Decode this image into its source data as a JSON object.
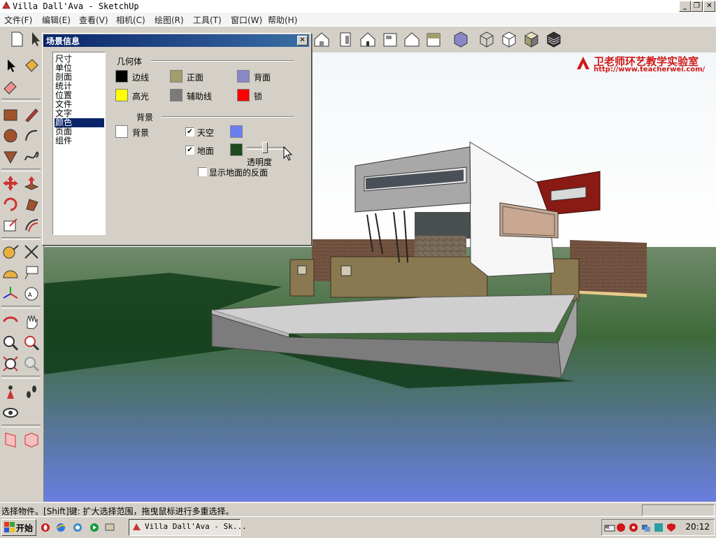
{
  "window": {
    "title": "Villa Dall'Ava - SketchUp",
    "minimize": "_",
    "restore": "❐",
    "close": "✕"
  },
  "menu": [
    "文件(F)",
    "编辑(E)",
    "查看(V)",
    "相机(C)",
    "绘图(R)",
    "工具(T)",
    "窗口(W)",
    "帮助(H)"
  ],
  "watermark": {
    "name": "卫老师环艺教学实验室",
    "url": "http://www.teacherwei.com/"
  },
  "dialog": {
    "title": "场景信息",
    "close": "✕",
    "categories": [
      "尺寸",
      "单位",
      "剖面",
      "统计",
      "位置",
      "文件",
      "文字",
      "颜色",
      "页面",
      "组件"
    ],
    "selected_category": "颜色",
    "geometry_group": "几何体",
    "geometry": [
      {
        "label": "边线",
        "color": "#000000"
      },
      {
        "label": "正面",
        "color": "#a39d6b"
      },
      {
        "label": "背面",
        "color": "#8a87c8"
      },
      {
        "label": "高光",
        "color": "#ffff00"
      },
      {
        "label": "辅助线",
        "color": "#7a7a7a"
      },
      {
        "label": "锁",
        "color": "#ff0000"
      }
    ],
    "background_group": "背景",
    "background": {
      "label": "背景",
      "color": "#ffffff"
    },
    "sky": {
      "label": "天空",
      "checked": true,
      "color": "#6a80f0"
    },
    "ground": {
      "label": "地面",
      "checked": true,
      "color": "#1e4a1e"
    },
    "transparency": {
      "label": "透明度",
      "value": 0.45
    },
    "show_ground_back": {
      "label": "显示地面的反面",
      "checked": false
    }
  },
  "status": {
    "text": "选择物件。[Shift]键: 扩大选择范围，拖曳鼠标进行多重选择。"
  },
  "taskbar": {
    "start": "开始",
    "task": "Villa Dall'Ava - Sk...",
    "clock": "20:12",
    "tray_arrow": "«"
  }
}
